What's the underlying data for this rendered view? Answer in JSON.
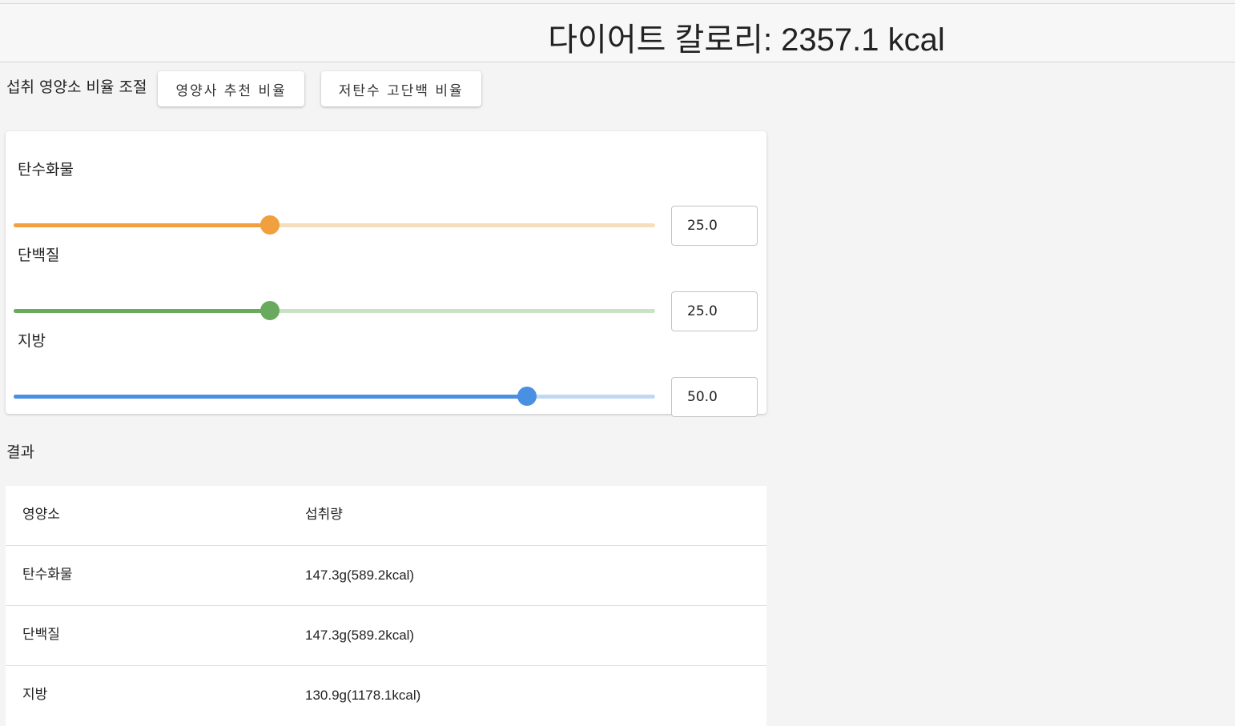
{
  "header": {
    "title": "다이어트 칼로리: 2357.1 kcal"
  },
  "ratio": {
    "label": "섭취 영양소 비율 조절",
    "buttons": [
      "영양사 추천 비율",
      "저탄수 고단백 비율"
    ]
  },
  "macros": [
    {
      "key": "carbs",
      "label": "탄수화물",
      "value": "25.0",
      "fraction": 0.4,
      "color": "#f0a03c",
      "track_color": "#f5debc"
    },
    {
      "key": "protein",
      "label": "단백질",
      "value": "25.0",
      "fraction": 0.4,
      "color": "#6aaa5e",
      "track_color": "#c9e2c4"
    },
    {
      "key": "fat",
      "label": "지방",
      "value": "50.0",
      "fraction": 0.8,
      "color": "#4a90e2",
      "track_color": "#c0d8f3"
    }
  ],
  "results": {
    "title": "결과",
    "headers": [
      "영양소",
      "섭취량"
    ],
    "rows": [
      [
        "탄수화물",
        "147.3g(589.2kcal)"
      ],
      [
        "단백질",
        "147.3g(589.2kcal)"
      ],
      [
        "지방",
        "130.9g(1178.1kcal)"
      ]
    ]
  }
}
